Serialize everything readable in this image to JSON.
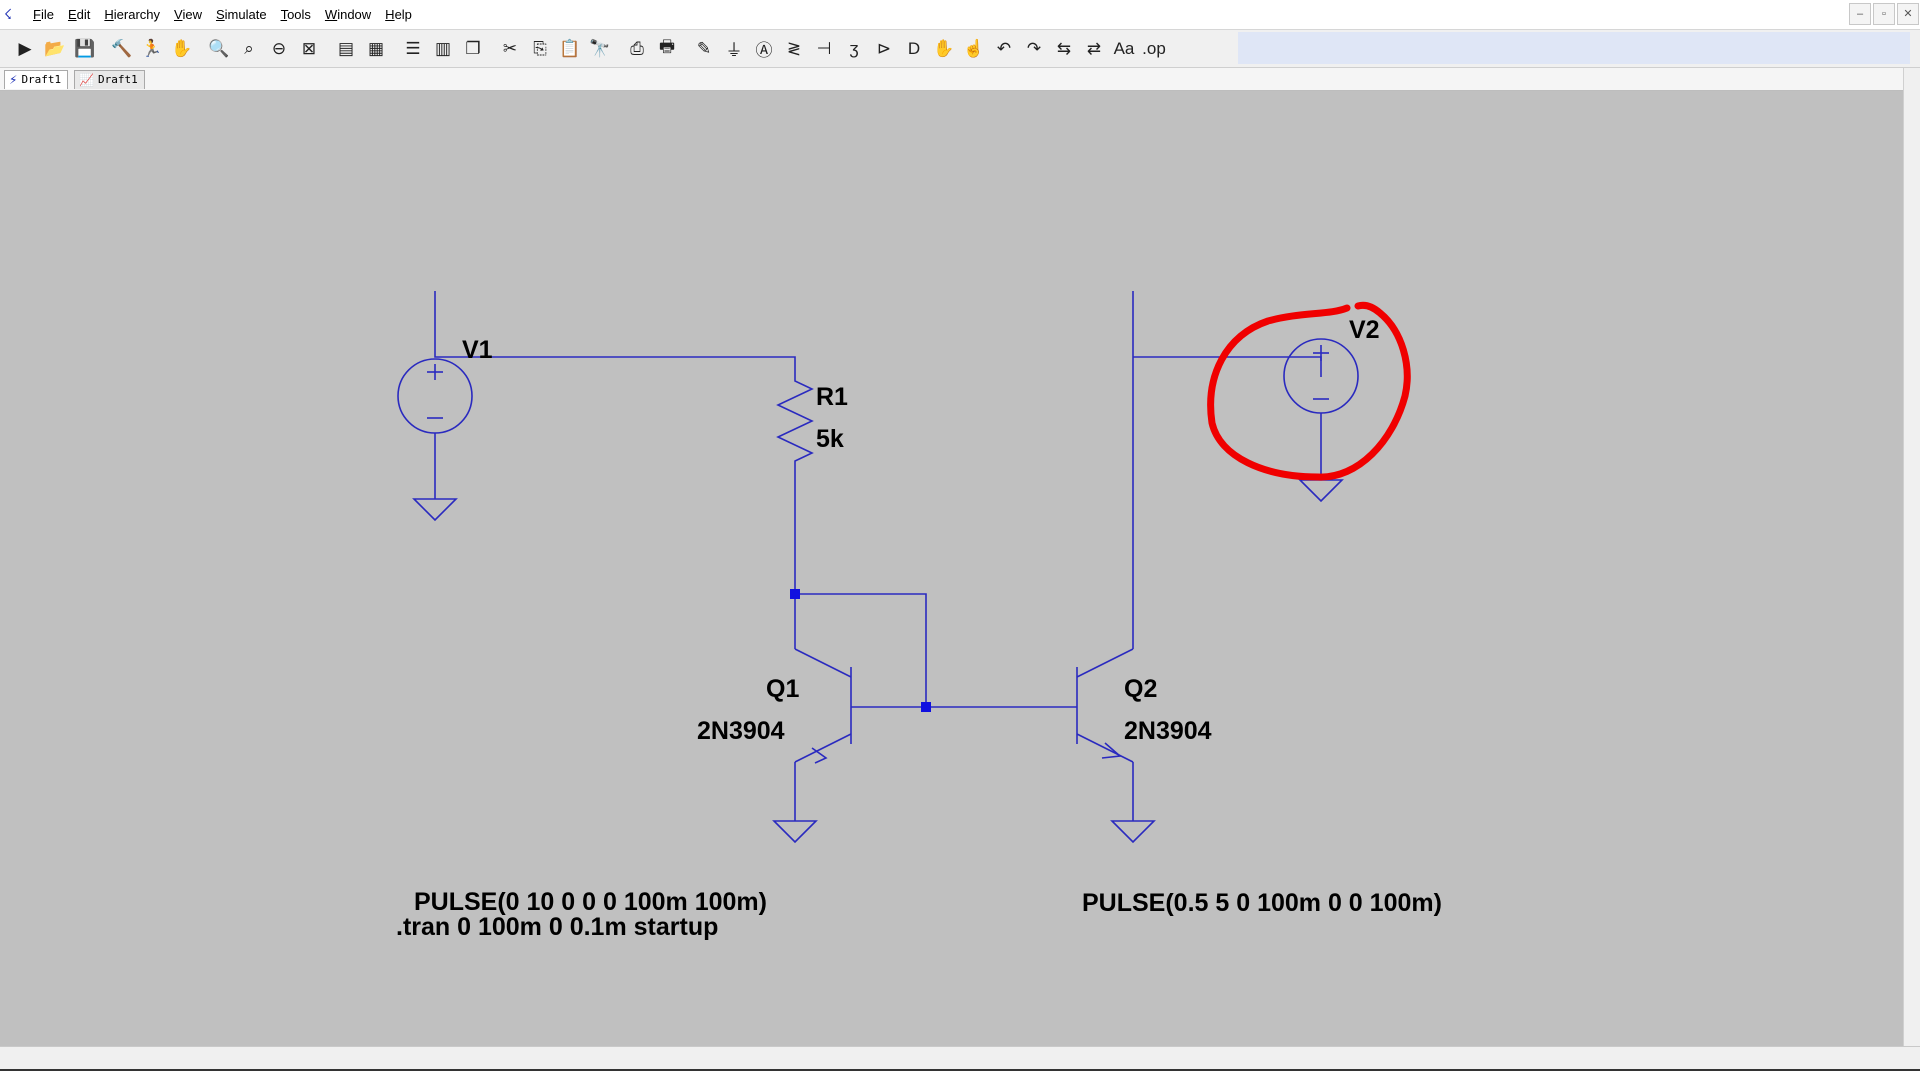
{
  "menubar": {
    "items": [
      "File",
      "Edit",
      "Hierarchy",
      "View",
      "Simulate",
      "Tools",
      "Window",
      "Help"
    ],
    "window_controls": [
      "–",
      "▫",
      "✕"
    ]
  },
  "toolbar": {
    "tools": [
      {
        "name": "run-icon",
        "glyph": "▶"
      },
      {
        "name": "open-icon",
        "glyph": "📂"
      },
      {
        "name": "save-icon",
        "glyph": "💾"
      },
      {
        "name": "control-panel-icon",
        "glyph": "🔨"
      },
      {
        "name": "run-pause-icon",
        "glyph": "🏃"
      },
      {
        "name": "halt-icon",
        "glyph": "✋"
      },
      {
        "name": "zoom-in-icon",
        "glyph": "🔍"
      },
      {
        "name": "pan-icon",
        "glyph": "⌕"
      },
      {
        "name": "zoom-out-icon",
        "glyph": "⊖"
      },
      {
        "name": "zoom-fit-icon",
        "glyph": "⊠"
      },
      {
        "name": "autorange-icon",
        "glyph": "▤"
      },
      {
        "name": "grid-icon",
        "glyph": "▦"
      },
      {
        "name": "tile-horizontal-icon",
        "glyph": "☰"
      },
      {
        "name": "tile-vertical-icon",
        "glyph": "▥"
      },
      {
        "name": "cascade-icon",
        "glyph": "❐"
      },
      {
        "name": "cut-icon",
        "glyph": "✂"
      },
      {
        "name": "copy-icon",
        "glyph": "⎘"
      },
      {
        "name": "paste-icon",
        "glyph": "📋"
      },
      {
        "name": "find-icon",
        "glyph": "🔭"
      },
      {
        "name": "print-icon",
        "glyph": "⎙"
      },
      {
        "name": "print-setup-icon",
        "glyph": "🖶"
      },
      {
        "name": "wire-icon",
        "glyph": "✎"
      },
      {
        "name": "ground-icon",
        "glyph": "⏚"
      },
      {
        "name": "label-net-icon",
        "glyph": "Ⓐ"
      },
      {
        "name": "resistor-icon",
        "glyph": "≷"
      },
      {
        "name": "capacitor-icon",
        "glyph": "⊣"
      },
      {
        "name": "inductor-icon",
        "glyph": "ʒ"
      },
      {
        "name": "diode-icon",
        "glyph": "⊳"
      },
      {
        "name": "component-icon",
        "glyph": "D"
      },
      {
        "name": "move-icon",
        "glyph": "✋"
      },
      {
        "name": "drag-icon",
        "glyph": "☝"
      },
      {
        "name": "undo-icon",
        "glyph": "↶"
      },
      {
        "name": "redo-icon",
        "glyph": "↷"
      },
      {
        "name": "rotate-icon",
        "glyph": "⇆"
      },
      {
        "name": "mirror-icon",
        "glyph": "⇄"
      },
      {
        "name": "text-icon",
        "glyph": "Aa"
      },
      {
        "name": "spice-directive-icon",
        "glyph": ".op"
      }
    ]
  },
  "tabs": [
    {
      "label": "Draft1",
      "icon": "schematic-icon",
      "glyph": "⚡"
    },
    {
      "label": "Draft1",
      "icon": "waveform-icon",
      "glyph": "📈"
    }
  ],
  "schematic": {
    "components": {
      "v1": {
        "name": "V1"
      },
      "r1": {
        "name": "R1",
        "value": "5k"
      },
      "v2": {
        "name": "V2"
      },
      "q1": {
        "name": "Q1",
        "model": "2N3904"
      },
      "q2": {
        "name": "Q2",
        "model": "2N3904"
      }
    },
    "directives": {
      "v1_source": "PULSE(0 10 0 0 0 100m 100m)",
      "tran": ".tran 0 100m 0 0.1m startup",
      "v2_source": "PULSE(0.5 5 0 100m 0 0 100m)"
    },
    "wire_color": "#2a2abf",
    "annotation_color": "#f00000"
  }
}
